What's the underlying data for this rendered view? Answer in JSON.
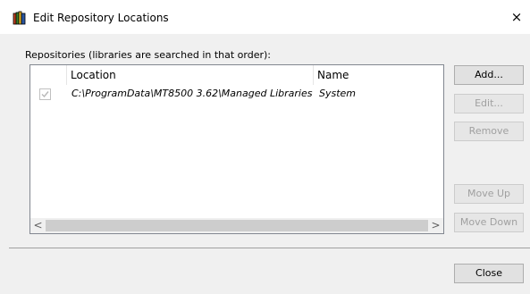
{
  "window": {
    "title": "Edit Repository Locations",
    "close_glyph": "×",
    "icon": "books-icon"
  },
  "repositories": {
    "label": "Repositories (libraries are searched in that order):",
    "columns": [
      "",
      "Location",
      "Name"
    ],
    "rows": [
      {
        "checked": true,
        "location": "C:\\ProgramData\\MT8500 3.62\\Managed Libraries",
        "name": "System"
      }
    ]
  },
  "buttons": {
    "add": "Add...",
    "edit": "Edit...",
    "remove": "Remove",
    "move_up": "Move Up",
    "move_down": "Move Down",
    "close": "Close"
  },
  "scrollbar": {
    "left_arrow": "<",
    "right_arrow": ">"
  }
}
